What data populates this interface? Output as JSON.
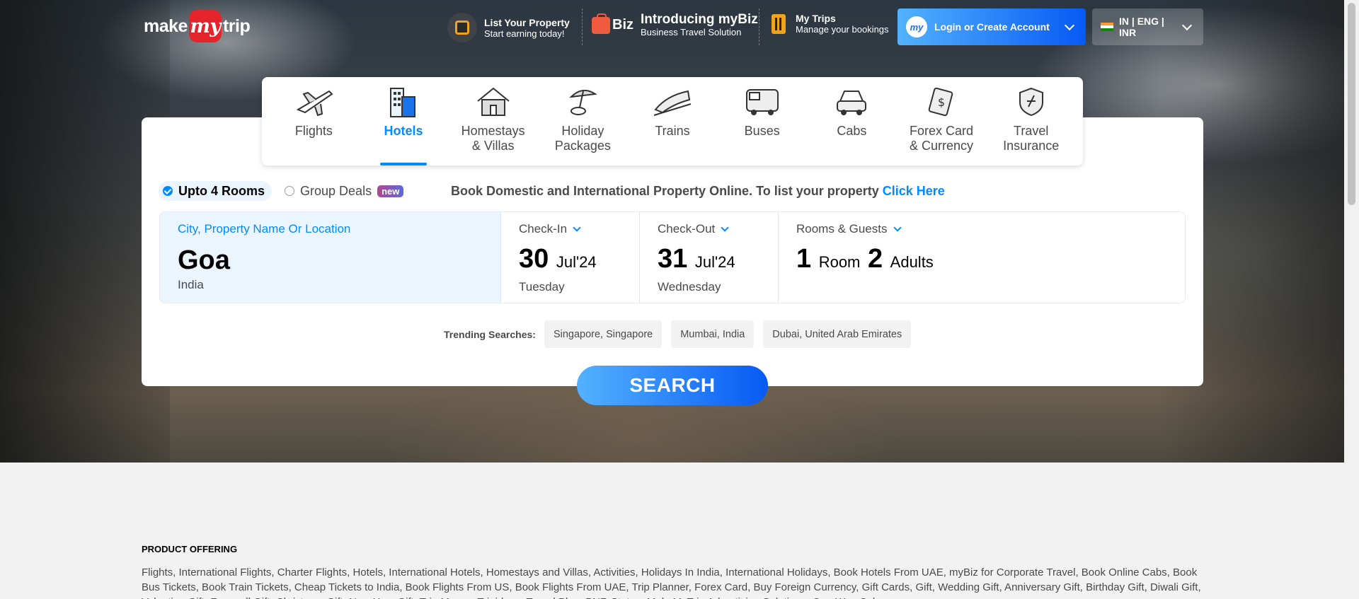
{
  "header": {
    "logo": {
      "part1": "make",
      "part2": "my",
      "part3": "trip"
    },
    "list_property": {
      "title": "List Your Property",
      "subtitle": "Start earning today!"
    },
    "mybiz": {
      "badge": "Biz",
      "title": "Introducing myBiz",
      "subtitle": "Business Travel Solution"
    },
    "my_trips": {
      "title": "My Trips",
      "subtitle": "Manage your bookings"
    },
    "login": {
      "avatar": "my",
      "label": "Login or Create Account"
    },
    "locale": {
      "label": "IN | ENG | INR"
    }
  },
  "nav": {
    "items": [
      {
        "label": "Flights",
        "icon": "plane-icon",
        "active": false
      },
      {
        "label": "Hotels",
        "icon": "hotel-icon",
        "active": true
      },
      {
        "label": "Homestays\n& Villas",
        "icon": "homestay-icon",
        "active": false
      },
      {
        "label": "Holiday\nPackages",
        "icon": "beach-umbrella-icon",
        "active": false
      },
      {
        "label": "Trains",
        "icon": "train-icon",
        "active": false
      },
      {
        "label": "Buses",
        "icon": "bus-icon",
        "active": false
      },
      {
        "label": "Cabs",
        "icon": "cab-icon",
        "active": false
      },
      {
        "label": "Forex Card\n& Currency",
        "icon": "forex-icon",
        "active": false
      },
      {
        "label": "Travel\nInsurance",
        "icon": "insurance-icon",
        "active": false
      }
    ]
  },
  "room_options": {
    "upto4": "Upto 4 Rooms",
    "group": "Group Deals",
    "new_badge": "new"
  },
  "tagline": {
    "text": "Book Domestic and International Property Online. To list your property ",
    "link": "Click Here"
  },
  "search": {
    "city": {
      "label": "City, Property Name Or Location",
      "value": "Goa",
      "sub": "India"
    },
    "checkin": {
      "label": "Check-In",
      "day": "30",
      "month": "Jul'24",
      "weekday": "Tuesday"
    },
    "checkout": {
      "label": "Check-Out",
      "day": "31",
      "month": "Jul'24",
      "weekday": "Wednesday"
    },
    "rooms": {
      "label": "Rooms & Guests",
      "rooms_num": "1",
      "rooms_word": "Room",
      "adults_num": "2",
      "adults_word": "Adults"
    }
  },
  "trending": {
    "label": "Trending Searches:",
    "chips": [
      "Singapore, Singapore",
      "Mumbai, India",
      "Dubai, United Arab Emirates"
    ]
  },
  "search_button": "SEARCH",
  "footer": {
    "heading": "PRODUCT OFFERING",
    "text": "Flights, International Flights, Charter Flights, Hotels, International Hotels, Homestays and Villas, Activities, Holidays In India, International Holidays, Book Hotels From UAE, myBiz for Corporate Travel, Book Online Cabs, Book Bus Tickets, Book Train Tickets, Cheap Tickets to India, Book Flights From US, Book Flights From UAE, Trip Planner, Forex Card, Buy Foreign Currency, Gift Cards, Gift, Wedding Gift, Anniversary Gift, Birthday Gift, Diwali Gift, Valentine Gift, Farewell Gift, Christmas Gift, New Year Gift, Trip Money, Tripideas, Travel Blog, PNR Status, MakeMyTrip Advertising Solutions, One Way Cab"
  },
  "colors": {
    "accent": "#008cff",
    "brand_red": "#e4232b",
    "gradient_start": "#53b2fe",
    "gradient_end": "#065af3"
  }
}
